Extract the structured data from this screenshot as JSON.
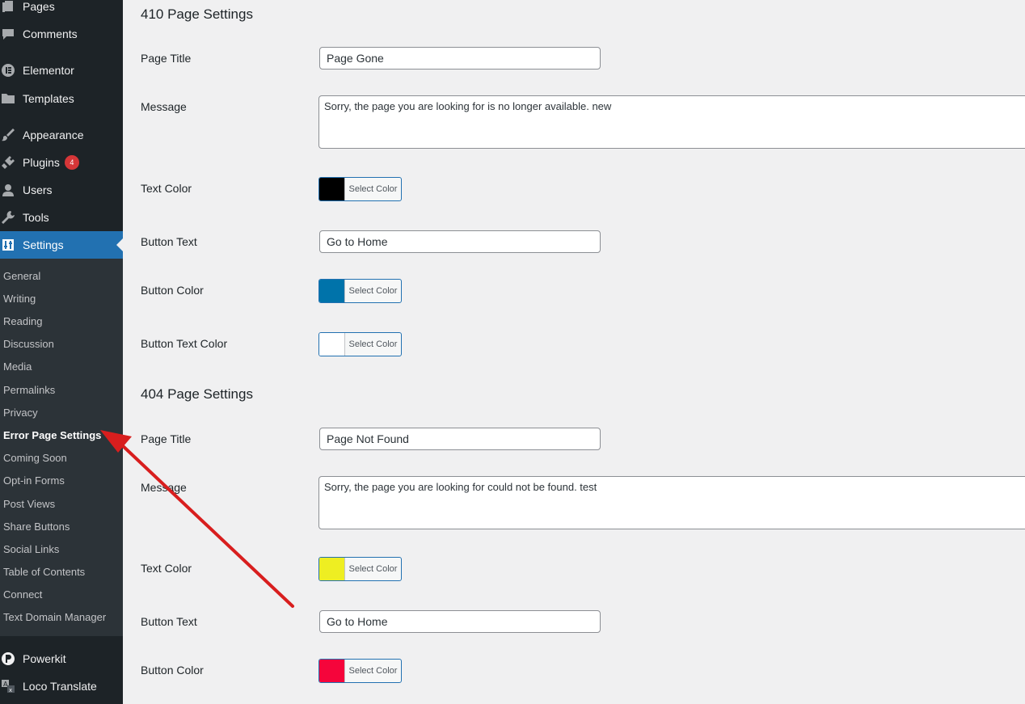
{
  "sidebar": {
    "menu": [
      {
        "label": "Pages",
        "icon": "pages-icon"
      },
      {
        "label": "Comments",
        "icon": "comments-icon"
      },
      {
        "label": "Elementor",
        "icon": "elementor-icon"
      },
      {
        "label": "Templates",
        "icon": "folder-icon"
      },
      {
        "label": "Appearance",
        "icon": "paintbrush-icon"
      },
      {
        "label": "Plugins",
        "icon": "plugin-icon",
        "badge": "4"
      },
      {
        "label": "Users",
        "icon": "user-icon"
      },
      {
        "label": "Tools",
        "icon": "wrench-icon"
      },
      {
        "label": "Settings",
        "icon": "settings-icon",
        "current": true
      }
    ],
    "submenu": [
      "General",
      "Writing",
      "Reading",
      "Discussion",
      "Media",
      "Permalinks",
      "Privacy",
      "Error Page Settings",
      "Coming Soon",
      "Opt-in Forms",
      "Post Views",
      "Share Buttons",
      "Social Links",
      "Table of Contents",
      "Connect",
      "Text Domain Manager"
    ],
    "submenu_active": "Error Page Settings",
    "bottom_menu": [
      {
        "label": "Powerkit",
        "icon": "powerkit-icon"
      },
      {
        "label": "Loco Translate",
        "icon": "translate-icon"
      }
    ]
  },
  "sections": [
    {
      "title": "410 Page Settings",
      "page_title_label": "Page Title",
      "page_title_value": "Page Gone",
      "message_label": "Message",
      "message_value": "Sorry, the page you are looking for is no longer available. new",
      "text_color_label": "Text Color",
      "text_color": "#000000",
      "button_text_label": "Button Text",
      "button_text_value": "Go to Home",
      "button_color_label": "Button Color",
      "button_color": "#0073aa",
      "button_text_color_label": "Button Text Color",
      "button_text_color": "#ffffff"
    },
    {
      "title": "404 Page Settings",
      "page_title_label": "Page Title",
      "page_title_value": "Page Not Found",
      "message_label": "Message",
      "message_value": "Sorry, the page you are looking for could not be found. test",
      "text_color_label": "Text Color",
      "text_color": "#eeee22",
      "button_text_label": "Button Text",
      "button_text_value": "Go to Home",
      "button_color_label": "Button Color",
      "button_color": "#f5053b"
    }
  ],
  "select_color_label": "Select Color",
  "colors": {
    "sidebar_bg": "#1d2327",
    "submenu_bg": "#2c3338",
    "accent": "#2271b1",
    "badge": "#d63638",
    "annotation_arrow": "#d81e1e"
  }
}
